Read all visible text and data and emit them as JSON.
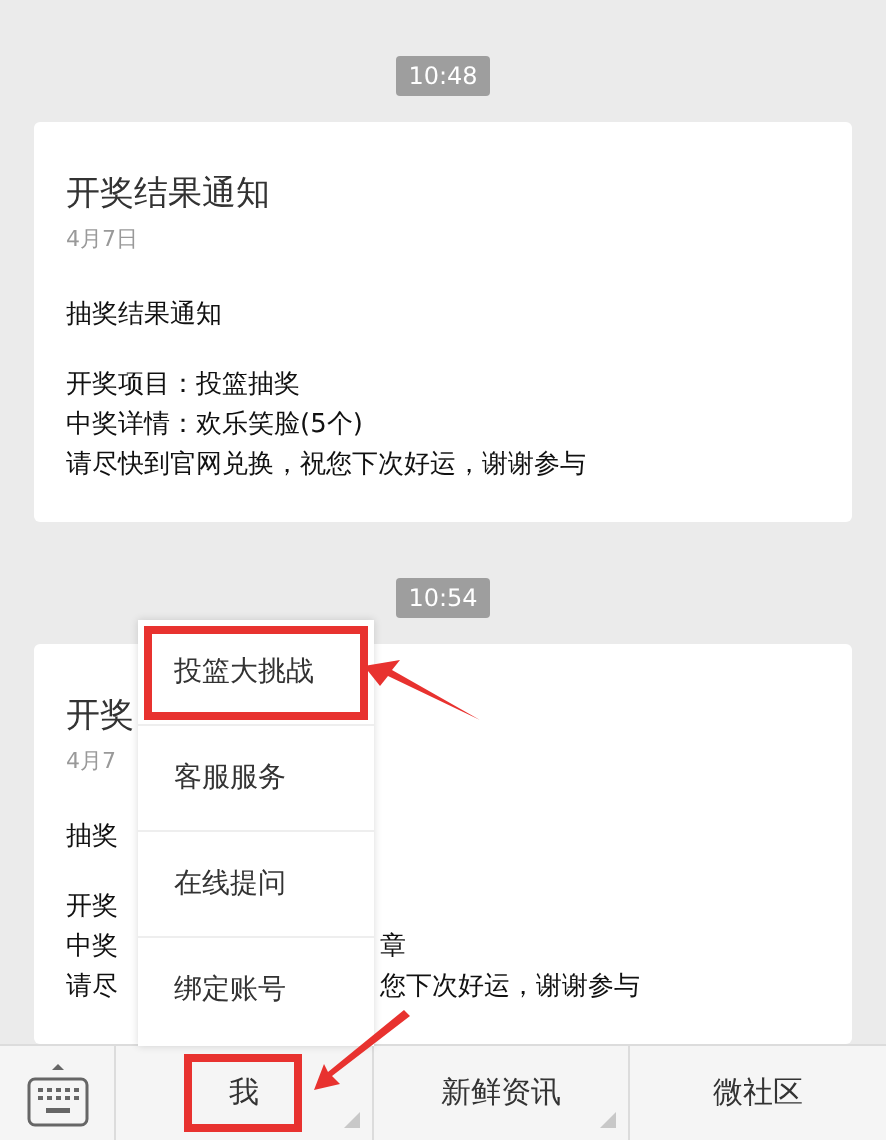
{
  "messages": [
    {
      "time": "10:48",
      "card": {
        "title": "开奖结果通知",
        "date": "4月7日",
        "heading": "抽奖结果通知",
        "lines": [
          {
            "left": "开奖项目：投篮抽奖"
          },
          {
            "left": "中奖详情：欢乐笑脸(5个)"
          },
          {
            "left": "请尽快到官网兑换，祝您下次好运，谢谢参与"
          }
        ]
      }
    },
    {
      "time": "10:54",
      "card": {
        "title": "开奖",
        "date": "4月7",
        "heading": "抽奖",
        "lines": [
          {
            "left": "开奖"
          },
          {
            "left": "中奖",
            "right": "章"
          },
          {
            "left": "请尽",
            "right": "您下次好运，谢谢参与"
          }
        ]
      }
    }
  ],
  "popup_menu": {
    "items": [
      {
        "label": "投篮大挑战",
        "highlighted": true
      },
      {
        "label": "客服服务",
        "highlighted": false
      },
      {
        "label": "在线提问",
        "highlighted": false
      },
      {
        "label": "绑定账号",
        "highlighted": false
      }
    ]
  },
  "bottom_bar": {
    "menus": [
      {
        "label": "我",
        "has_submenu": true,
        "highlighted": true
      },
      {
        "label": "新鲜资讯",
        "has_submenu": true,
        "highlighted": false
      },
      {
        "label": "微社区",
        "has_submenu": false,
        "highlighted": false
      }
    ]
  }
}
